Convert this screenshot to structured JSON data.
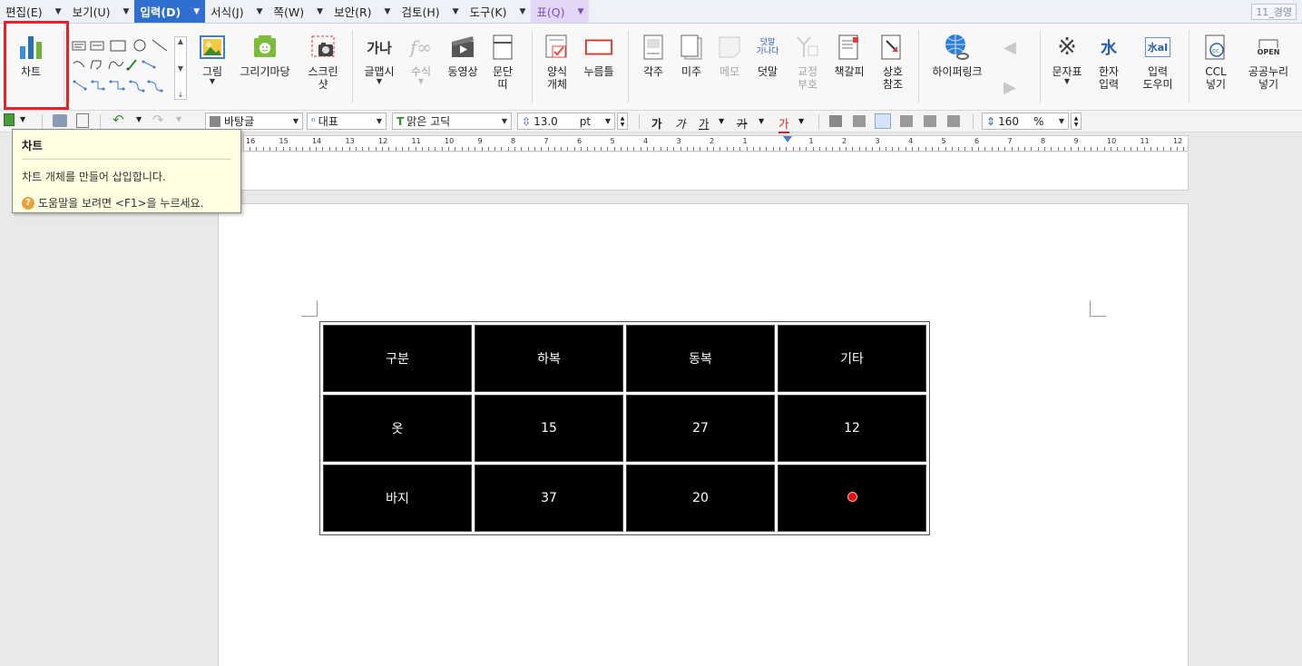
{
  "menu": {
    "items": [
      {
        "label": "편집(E)",
        "active": false
      },
      {
        "label": "보기(U)",
        "active": false
      },
      {
        "label": "입력(D)",
        "active": true
      },
      {
        "label": "서식(J)",
        "active": false
      },
      {
        "label": "쪽(W)",
        "active": false
      },
      {
        "label": "보안(R)",
        "active": false
      },
      {
        "label": "검토(H)",
        "active": false
      },
      {
        "label": "도구(K)",
        "active": false
      },
      {
        "label": "표(Q)",
        "active": false
      }
    ],
    "right_box": "11_경영"
  },
  "ribbon": {
    "chart": "차트",
    "picture": "그림",
    "drawing_maru": "그리기마당",
    "screenshot": "스크린\n샷",
    "glyph_art": "글맵시",
    "formula": "수식",
    "video": "동영상",
    "paragraph_frame": "문단\n띠",
    "form_object": "양식\n개체",
    "push_button": "누름틀",
    "footnote": "각주",
    "endnote": "미주",
    "memo": "메모",
    "overlap": "덧말",
    "proofread": "교정\n부호",
    "bookmark": "책갈피",
    "cross_ref": "상호\n참조",
    "hyperlink": "하이퍼링크",
    "symbol_table": "문자표",
    "hanja_input": "한자\n입력",
    "input_helper": "입력\n도우미",
    "ccl": "CCL\n넣기",
    "public_nuri": "공공누리\n넣기",
    "overlap_icon_text": "덧말\n가나다",
    "open_icon_text": "OPEN",
    "hanja_icon_text": "水",
    "input_icon_text": "水aI",
    "ga_na_icon_text": "가나"
  },
  "format_toolbar": {
    "style": "바탕글",
    "font_lang": "대표",
    "font": "맑은 고딕",
    "font_size": "13.0",
    "size_unit": "pt",
    "line_spacing": "160",
    "line_unit": "%",
    "bold": "가",
    "italic": "가",
    "underline": "가",
    "strike": "가",
    "color_letter": "가"
  },
  "ruler": {
    "numbers_left": [
      "16",
      "15",
      "14",
      "13",
      "12",
      "11",
      "10",
      "9",
      "8",
      "7",
      "6",
      "5",
      "4",
      "3",
      "2",
      "1"
    ],
    "numbers_right": [
      "1",
      "2",
      "3",
      "4",
      "5",
      "6",
      "7",
      "8",
      "9",
      "10",
      "11",
      "12"
    ]
  },
  "tooltip": {
    "title": "차트",
    "description": "차트 개체를 만들어 삽입합니다.",
    "help": "도움말을 보려면 <F1>을 누르세요."
  },
  "table": {
    "rows": [
      [
        "구분",
        "하복",
        "동복",
        "기타"
      ],
      [
        "옷",
        "15",
        "27",
        "12"
      ],
      [
        "바지",
        "37",
        "20",
        ""
      ]
    ]
  },
  "colors": {
    "active_menu": "#2e6fd0",
    "highlight": "#e8202a",
    "table_cell": "#000000",
    "red_dot": "#e01010"
  }
}
